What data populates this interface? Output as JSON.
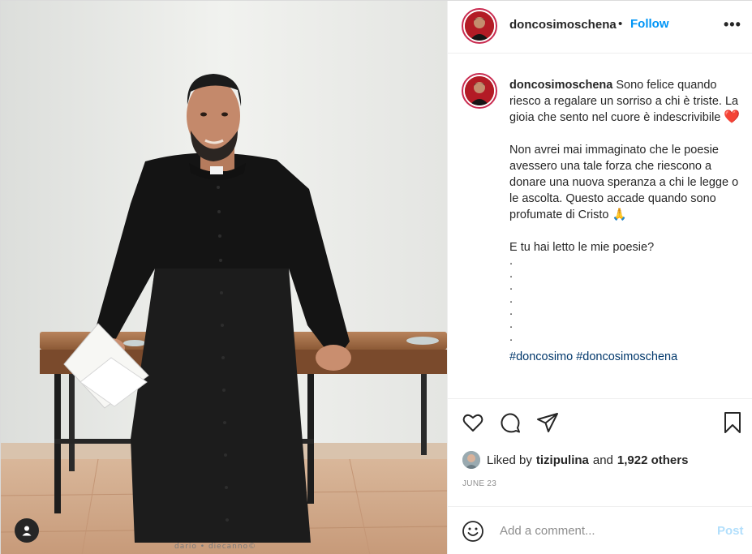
{
  "header": {
    "username": "doncosimoschena",
    "separator": "•",
    "follow_label": "Follow",
    "more_label": "•••"
  },
  "caption": {
    "username": "doncosimoschena",
    "paragraph1": "Sono felice quando riesco a regalare un sorriso a chi è triste. La gioia che sento nel cuore è indescrivibile",
    "heart_emoji": "❤️",
    "paragraph2": "Non avrei mai immaginato che le poesie avessero una tale forza che riescono a donare una nuova speranza a chi le legge o le ascolta. Questo accade quando sono profumate di Cristo",
    "pray_emoji": "🙏",
    "paragraph3": "E tu hai letto le mie poesie?",
    "dots": [
      ".",
      ".",
      ".",
      ".",
      ".",
      ".",
      "."
    ],
    "hashtags": [
      "#doncosimo",
      "#doncosimoschena"
    ]
  },
  "actions": {
    "like_icon": "heart-outline-icon",
    "comment_icon": "comment-bubble-icon",
    "share_icon": "paper-plane-icon",
    "save_icon": "bookmark-icon"
  },
  "likes": {
    "prefix": "Liked by",
    "liker": "tizipulina",
    "conjunction": "and",
    "others": "1,922 others"
  },
  "date": "JUNE 23",
  "comment": {
    "placeholder": "Add a comment...",
    "post_label": "Post"
  },
  "photo": {
    "watermark": "dario • diecanno©",
    "tag_icon": "user-tag-icon"
  },
  "colors": {
    "follow_blue": "#0095f6",
    "hashtag_blue": "#00376b",
    "post_disabled": "#b2dffc",
    "muted_text": "#8e8e8e",
    "story_ring": "#c92a4f"
  }
}
